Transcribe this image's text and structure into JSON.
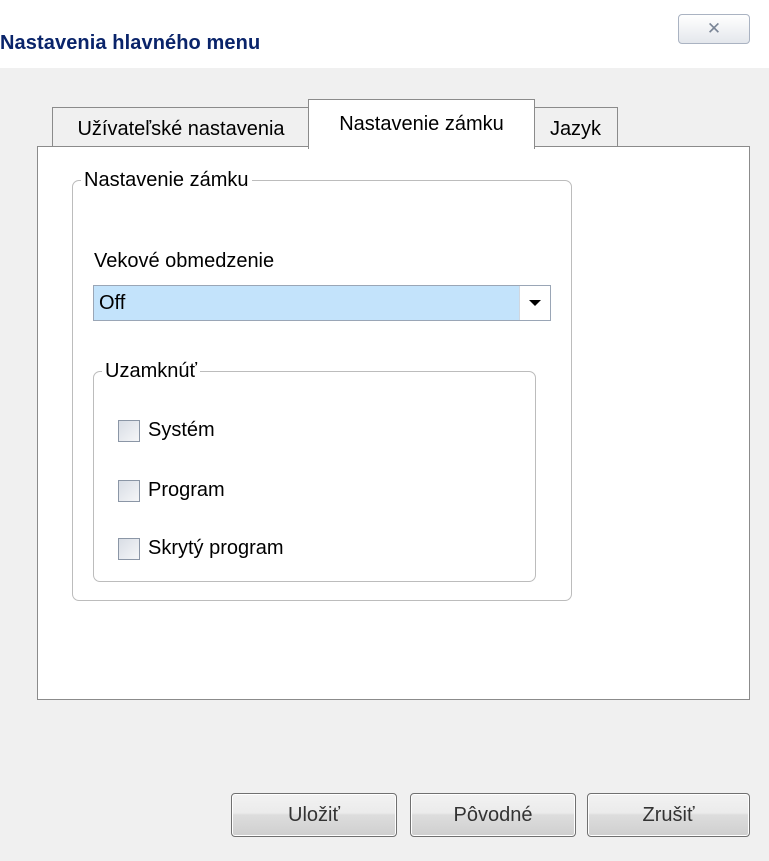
{
  "window": {
    "title": "Nastavenia hlavného menu",
    "close_icon": "close-icon"
  },
  "tabs": [
    {
      "label": "Užívateľské nastavenia",
      "active": false
    },
    {
      "label": "Nastavenie zámku",
      "active": true
    },
    {
      "label": "Jazyk",
      "active": false
    }
  ],
  "lock_group": {
    "legend": "Nastavenie zámku",
    "age_label": "Vekové obmedzenie",
    "age_select": {
      "value": "Off",
      "arrow_icon": "dropdown-arrow-icon"
    }
  },
  "uzamknut_group": {
    "legend": "Uzamknúť",
    "items": [
      {
        "label": "Systém",
        "checked": false
      },
      {
        "label": "Program",
        "checked": false
      },
      {
        "label": "Skrytý program",
        "checked": false
      }
    ]
  },
  "buttons": {
    "save": "Uložiť",
    "default": "Pôvodné",
    "cancel": "Zrušiť"
  },
  "colors": {
    "title": "#0a246a",
    "select_highlight": "#c3e3fb",
    "dialog_bg": "#f0f0f0"
  }
}
